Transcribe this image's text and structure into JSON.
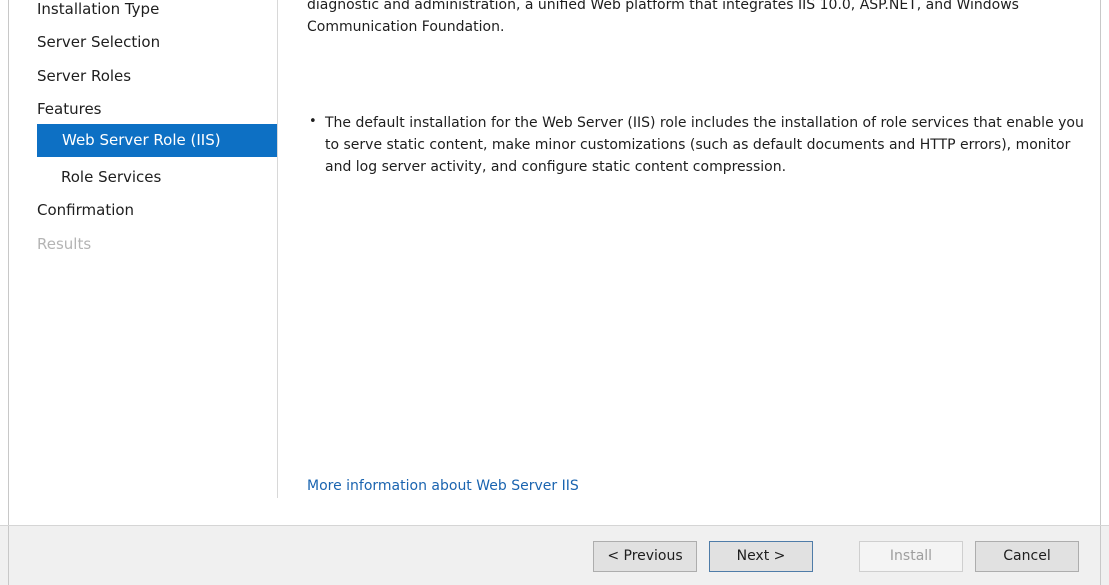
{
  "nav": {
    "items": [
      {
        "label": "Installation Type"
      },
      {
        "label": "Server Selection"
      },
      {
        "label": "Server Roles"
      },
      {
        "label": "Features"
      },
      {
        "label": "Web Server Role (IIS)"
      },
      {
        "label": "Role Services"
      },
      {
        "label": "Confirmation"
      },
      {
        "label": "Results"
      }
    ],
    "selected": "Web Server Role (IIS)"
  },
  "content": {
    "intro": "diagnostic and administration, a unified Web platform that integrates IIS 10.0, ASP.NET, and Windows Communication Foundation.",
    "bullet": "The default installation for the Web Server (IIS) role includes the installation of role services that enable you to serve static content, make minor customizations (such as default documents and HTTP errors), monitor and log server activity, and configure static content compression.",
    "more_link": "More information about Web Server IIS"
  },
  "buttons": {
    "previous": "< Previous",
    "next": "Next >",
    "install": "Install",
    "cancel": "Cancel"
  },
  "colors": {
    "accent": "#0d70c4",
    "link": "#1a64b0",
    "disabled_text": "#b4b4b4"
  }
}
